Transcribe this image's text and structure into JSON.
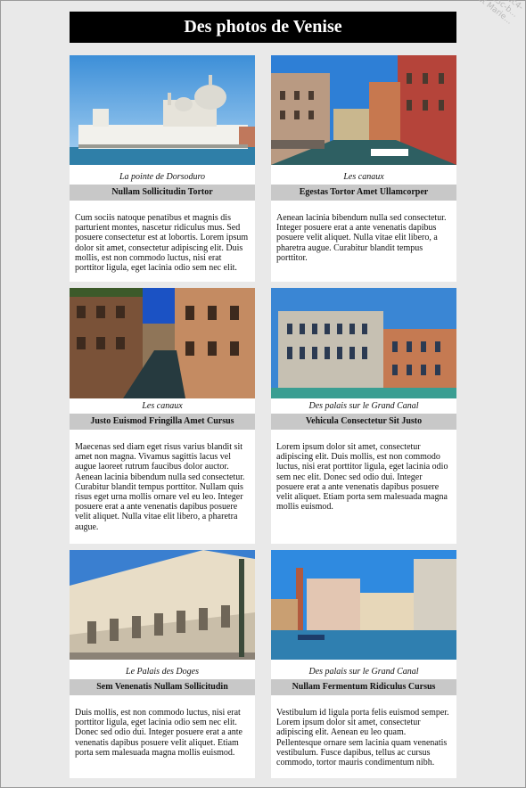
{
  "page": {
    "title": "Des photos de Venise",
    "watermark": "47cf9ec4-\n6e8a5c5c-b...\nOuelet Marie..."
  },
  "cards": [
    {
      "caption": "La pointe de Dorsoduro",
      "heading": "Nullam Sollicitudin Tortor",
      "text": "Cum sociis natoque penatibus et magnis dis parturient montes, nascetur ridiculus mus. Sed posuere consectetur est at lobortis. Lorem ipsum dolor sit amet, consectetur adipiscing elit. Duis mollis, est non commodo luctus, nisi erat porttitor ligula, eget lacinia odio sem nec elit."
    },
    {
      "caption": "Les canaux",
      "heading": "Egestas Tortor Amet Ullamcorper",
      "text": "Aenean lacinia bibendum nulla sed consectetur. Integer posuere erat a ante venenatis dapibus posuere velit aliquet. Nulla vitae elit libero, a pharetra augue. Curabitur blandit tempus porttitor."
    },
    {
      "caption": "Les canaux",
      "heading": "Justo Euismod Fringilla Amet Cursus",
      "text": "Maecenas sed diam eget risus varius blandit sit amet non magna. Vivamus sagittis lacus vel augue laoreet rutrum faucibus dolor auctor. Aenean lacinia bibendum nulla sed consectetur. Curabitur blandit tempus porttitor. Nullam quis risus eget urna mollis ornare vel eu leo. Integer posuere erat a ante venenatis dapibus posuere velit aliquet. Nulla vitae elit libero, a pharetra augue."
    },
    {
      "caption": "Des palais sur le Grand Canal",
      "heading": "Vehicula Consectetur Sit Justo",
      "text": "Lorem ipsum dolor sit amet, consectetur adipiscing elit. Duis mollis, est non commodo luctus, nisi erat porttitor ligula, eget lacinia odio sem nec elit. Donec sed odio dui. Integer posuere erat a ante venenatis dapibus posuere velit aliquet. Etiam porta sem malesuada magna mollis euismod."
    },
    {
      "caption": "Le Palais des Doges",
      "heading": "Sem Venenatis Nullam Sollicitudin",
      "text": "Duis mollis, est non commodo luctus, nisi erat porttitor ligula, eget lacinia odio sem nec elit. Donec sed odio dui. Integer posuere erat a ante venenatis dapibus posuere velit aliquet. Etiam porta sem malesuada magna mollis euismod."
    },
    {
      "caption": "Des palais sur le Grand Canal",
      "heading": "Nullam Fermentum Ridiculus Cursus",
      "text": "Vestibulum id ligula porta felis euismod semper. Lorem ipsum dolor sit amet, consectetur adipiscing elit. Aenean eu leo quam. Pellentesque ornare sem lacinia quam venenatis vestibulum. Fusce dapibus, tellus ac cursus commodo, tortor mauris condimentum nibh."
    }
  ]
}
